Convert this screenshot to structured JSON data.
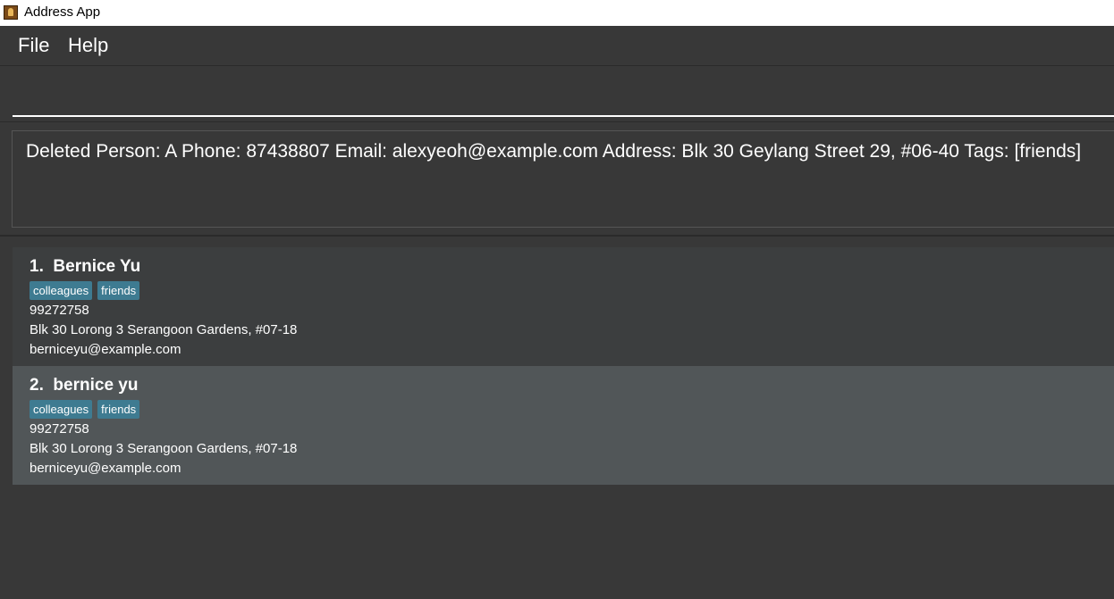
{
  "window": {
    "title": "Address App"
  },
  "menu": {
    "file": "File",
    "help": "Help"
  },
  "command": {
    "value": ""
  },
  "result": {
    "text": "Deleted Person: A Phone: 87438807 Email: alexyeoh@example.com Address: Blk 30 Geylang Street 29, #06-40 Tags: [friends]"
  },
  "persons": [
    {
      "index": "1.",
      "name": "Bernice Yu",
      "tags": [
        "colleagues",
        "friends"
      ],
      "phone": "99272758",
      "address": "Blk 30 Lorong 3 Serangoon Gardens, #07-18",
      "email": "berniceyu@example.com"
    },
    {
      "index": "2.",
      "name": "bernice yu",
      "tags": [
        "colleagues",
        "friends"
      ],
      "phone": "99272758",
      "address": "Blk 30 Lorong 3 Serangoon Gardens, #07-18",
      "email": "berniceyu@example.com"
    }
  ]
}
